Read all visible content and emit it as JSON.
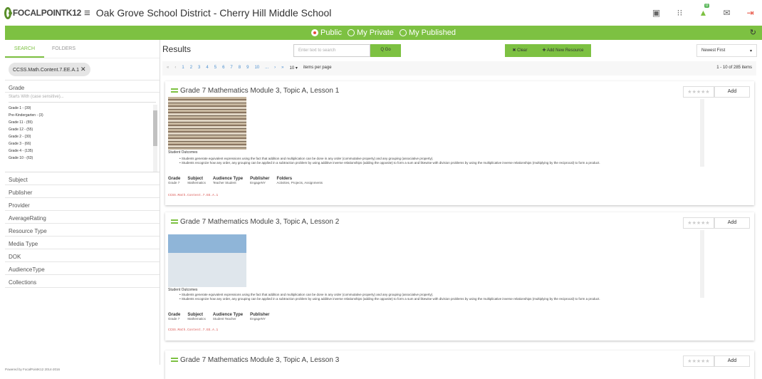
{
  "brand": {
    "name": "FOCALPOINTK12"
  },
  "header": {
    "title": "Oak Grove School District - Cherry Hill Middle School",
    "notif_count": "0"
  },
  "visibility": {
    "options": [
      "Public",
      "My Private",
      "My Published"
    ],
    "selected": "Public"
  },
  "sidebar": {
    "tabs": [
      "SEARCH",
      "FOLDERS"
    ],
    "active_tab": "SEARCH",
    "chip": "CCSS.Math.Content.7.EE.A.1",
    "grade_label": "Grade",
    "grade_placeholder": "Starts With (case sensitive)...",
    "grades": [
      "Grade 1 - (39)",
      "Pre-Kindergarten - (3)",
      "Grade 11 - (55)",
      "Grade 12 - (55)",
      "Grade 2 - (30)",
      "Grade 3 - (66)",
      "Grade 4 - (135)",
      "Grade 10 - (63)"
    ],
    "sections": [
      "Subject",
      "Publisher",
      "Provider",
      "AverageRating",
      "Resource Type",
      "Media Type",
      "DOK",
      "AudienceType",
      "Collections"
    ]
  },
  "main": {
    "title": "Results",
    "search_placeholder": "Enter text to search",
    "go_label": "Q Go",
    "clear_label": "✖ Clear",
    "add_new_label": "✚ Add New Resource",
    "sort_value": "Newest First",
    "pager": {
      "pages": [
        "1",
        "2",
        "3",
        "4",
        "5",
        "6",
        "7",
        "8",
        "9",
        "10",
        "..."
      ],
      "per_page": "10",
      "per_page_label": "items per page",
      "total": "1 - 10 of 285 items"
    }
  },
  "cards": [
    {
      "title": "Grade 7 Mathematics Module 3, Topic A, Lesson 1",
      "add": "Add",
      "outcomes_label": "Student Outcomes",
      "outcomes": [
        "Students generate equivalent expressions using the fact that addition and multiplication can be done in any order (commutative property) and any grouping (associative property).",
        "Students recognize how any order, any grouping can be applied in a subtraction problem by using additive inverse relationships (adding the opposite) to form a sum and likewise with division problems by using the multiplicative inverse relationships (multiplying by the reciprocal) to form a product."
      ],
      "meta": [
        {
          "h": "Grade",
          "v": "Grade 7"
        },
        {
          "h": "Subject",
          "v": "Mathematics"
        },
        {
          "h": "Audience Type",
          "v": "Teacher Student"
        },
        {
          "h": "Publisher",
          "v": "EngageNY"
        },
        {
          "h": "Folders",
          "v": "Activities, Projects, Assignments"
        }
      ],
      "standard": "CCSS.Math.Content.7.EE.A.1"
    },
    {
      "title": "Grade 7 Mathematics Module 3, Topic A, Lesson 2",
      "add": "Add",
      "outcomes_label": "Student Outcomes",
      "outcomes": [
        "Students generate equivalent expressions using the fact that addition and multiplication can be done in any order (commutative property) and any grouping (associative property).",
        "Students recognize how any order, any grouping can be applied in a subtraction problem by using additive inverse relationships (adding the opposite) to form a sum and likewise with division problems by using the multiplicative inverse relationships (multiplying by the reciprocal) to form a product."
      ],
      "meta": [
        {
          "h": "Grade",
          "v": "Grade 7"
        },
        {
          "h": "Subject",
          "v": "Mathematics"
        },
        {
          "h": "Audience Type",
          "v": "Student Teacher"
        },
        {
          "h": "Publisher",
          "v": "EngageNY"
        }
      ],
      "standard": "CCSS.Math.Content.7.EE.A.1"
    },
    {
      "title": "Grade 7 Mathematics Module 3, Topic A, Lesson 3",
      "add": "Add"
    }
  ],
  "footer": "Powered by FocalPointK12 2014-2016",
  "colors": {
    "green": "#7dc142",
    "brand_dark": "#5a8f2b"
  }
}
